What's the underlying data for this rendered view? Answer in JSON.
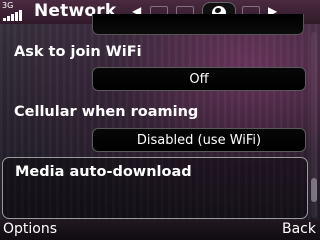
{
  "status": {
    "network_type": "3G"
  },
  "header": {
    "title": "Network",
    "tabs": [
      {
        "icon": "settings-tab-icon",
        "active": false
      },
      {
        "icon": "phone-tab-icon",
        "active": false
      },
      {
        "icon": "globe-icon",
        "active": true
      },
      {
        "icon": "display-tab-icon",
        "active": false
      }
    ]
  },
  "settings": [
    {
      "label": "Ask to join WiFi",
      "value": "Off"
    },
    {
      "label": "Cellular when roaming",
      "value": "Disabled (use WiFi)"
    },
    {
      "label": "Media auto-download",
      "value": ""
    }
  ],
  "softkeys": {
    "left": "Options",
    "right": "Back"
  },
  "scroll": {
    "position_fraction": 0.9
  }
}
